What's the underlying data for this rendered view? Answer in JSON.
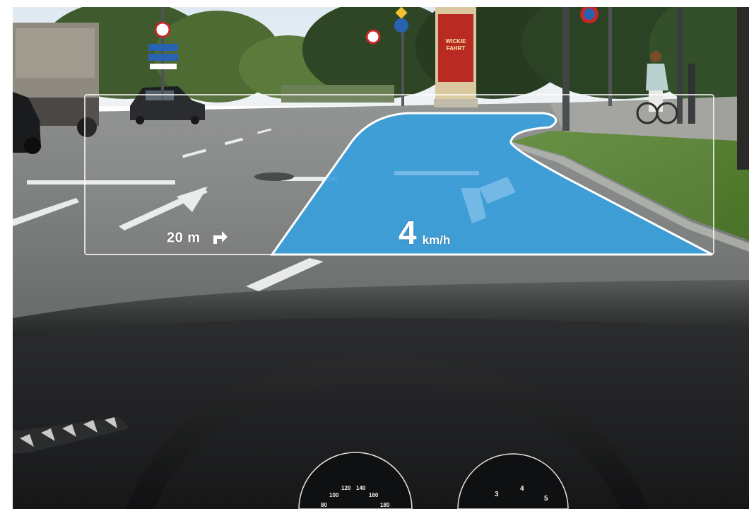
{
  "hud": {
    "distance_label": "20 m",
    "turn_icon": "turn-right-arrow-icon",
    "speed_value": "4",
    "speed_unit": "km/h",
    "lane_highlight_color": "#3a9fdc"
  },
  "instrument_cluster": {
    "speedometer_ticks": [
      "80",
      "100",
      "120",
      "140",
      "160",
      "180"
    ],
    "tachometer_ticks": [
      "3",
      "4",
      "5"
    ]
  },
  "scene": {
    "billboard_text": "WICKIE FAHRT"
  }
}
